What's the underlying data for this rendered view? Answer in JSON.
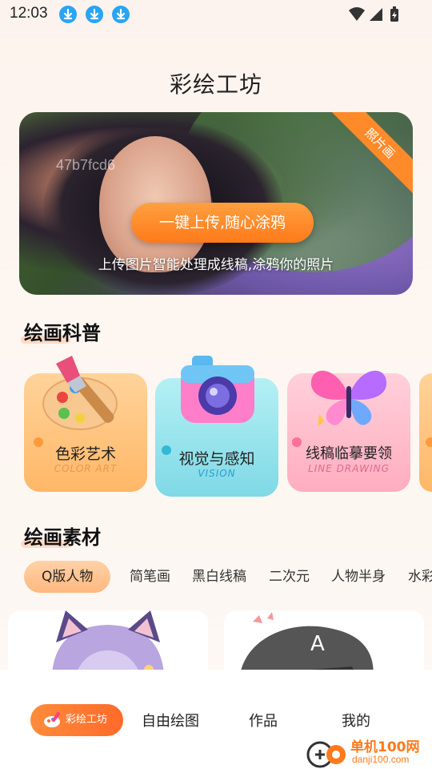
{
  "status_bar": {
    "time": "12:03",
    "download_icons": [
      "download-icon",
      "download-icon",
      "download-icon"
    ],
    "system_icons": [
      "wifi-icon",
      "signal-icon",
      "battery-icon"
    ]
  },
  "header": {
    "title": "彩绘工坊"
  },
  "banner": {
    "ribbon": "照片画",
    "watermark": "47b7fcd6",
    "cta": "一键上传,随心涂鸦",
    "subtitle": "上传图片智能处理成线稿,涂鸦你的照片"
  },
  "science_section": {
    "title": "绘画科普",
    "cards": [
      {
        "label": "色彩艺术",
        "sub": "COLOR ART",
        "icon": "palette-icon",
        "color": "#ffbf78"
      },
      {
        "label": "视觉与感知",
        "sub": "VISION",
        "icon": "camera-icon",
        "color": "#8fe0ea"
      },
      {
        "label": "线稿临摹要领",
        "sub": "LINE DRAWING",
        "icon": "butterfly-icon",
        "color": "#ffb3c4"
      }
    ]
  },
  "material_section": {
    "title": "绘画素材",
    "tabs": [
      "Q版人物",
      "简笔画",
      "黑白线稿",
      "二次元",
      "人物半身",
      "水彩"
    ],
    "active_tab": 0
  },
  "bottom_nav": {
    "items": [
      "彩绘工坊",
      "自由绘图",
      "作品",
      "我的"
    ],
    "active": 0
  },
  "watermark": {
    "brand": "单机100网",
    "url": "danji100.com"
  },
  "colors": {
    "accent": "#ff7a1a",
    "download_blue": "#2aa4f4"
  }
}
